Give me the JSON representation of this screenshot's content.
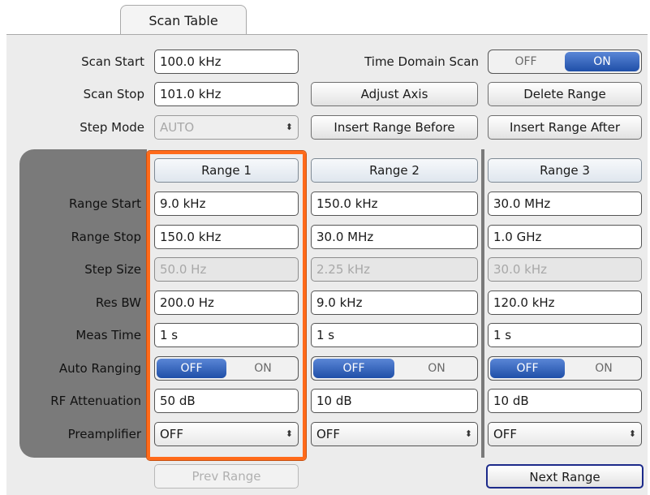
{
  "tab": {
    "label": "Scan Table"
  },
  "scan": {
    "start_label": "Scan Start",
    "start_value": "100.0 kHz",
    "stop_label": "Scan Stop",
    "stop_value": "101.0 kHz",
    "step_mode_label": "Step Mode",
    "step_mode_value": "AUTO",
    "time_domain_label": "Time Domain Scan",
    "time_domain_off": "OFF",
    "time_domain_on": "ON",
    "time_domain_state": "ON"
  },
  "actions": {
    "adjust_axis": "Adjust Axis",
    "delete_range": "Delete Range",
    "insert_before": "Insert Range Before",
    "insert_after": "Insert Range After"
  },
  "labels": {
    "range_start": "Range Start",
    "range_stop": "Range Stop",
    "step_size": "Step Size",
    "res_bw": "Res BW",
    "meas_time": "Meas Time",
    "auto_ranging": "Auto Ranging",
    "rf_attenuation": "RF Attenuation",
    "preamplifier": "Preamplifier"
  },
  "ranges": [
    {
      "header": "Range 1",
      "start": "9.0 kHz",
      "stop": "150.0 kHz",
      "step": "50.0 Hz",
      "res_bw": "200.0 Hz",
      "meas_time": "1 s",
      "auto_off": "OFF",
      "auto_on": "ON",
      "auto_state": "OFF",
      "rf_att": "50 dB",
      "preamp": "OFF"
    },
    {
      "header": "Range 2",
      "start": "150.0 kHz",
      "stop": "30.0 MHz",
      "step": "2.25 kHz",
      "res_bw": "9.0 kHz",
      "meas_time": "1 s",
      "auto_off": "OFF",
      "auto_on": "ON",
      "auto_state": "OFF",
      "rf_att": "10 dB",
      "preamp": "OFF"
    },
    {
      "header": "Range 3",
      "start": "30.0 MHz",
      "stop": "1.0 GHz",
      "step": "30.0 kHz",
      "res_bw": "120.0 kHz",
      "meas_time": "1 s",
      "auto_off": "OFF",
      "auto_on": "ON",
      "auto_state": "OFF",
      "rf_att": "10 dB",
      "preamp": "OFF"
    }
  ],
  "nav": {
    "prev": "Prev Range",
    "next": "Next Range"
  },
  "colors": {
    "accent_selection": "#ff6a1a",
    "toggle_active": "#1f4fa8"
  },
  "icons": {
    "combo_arrow": "updown-arrows-icon"
  }
}
